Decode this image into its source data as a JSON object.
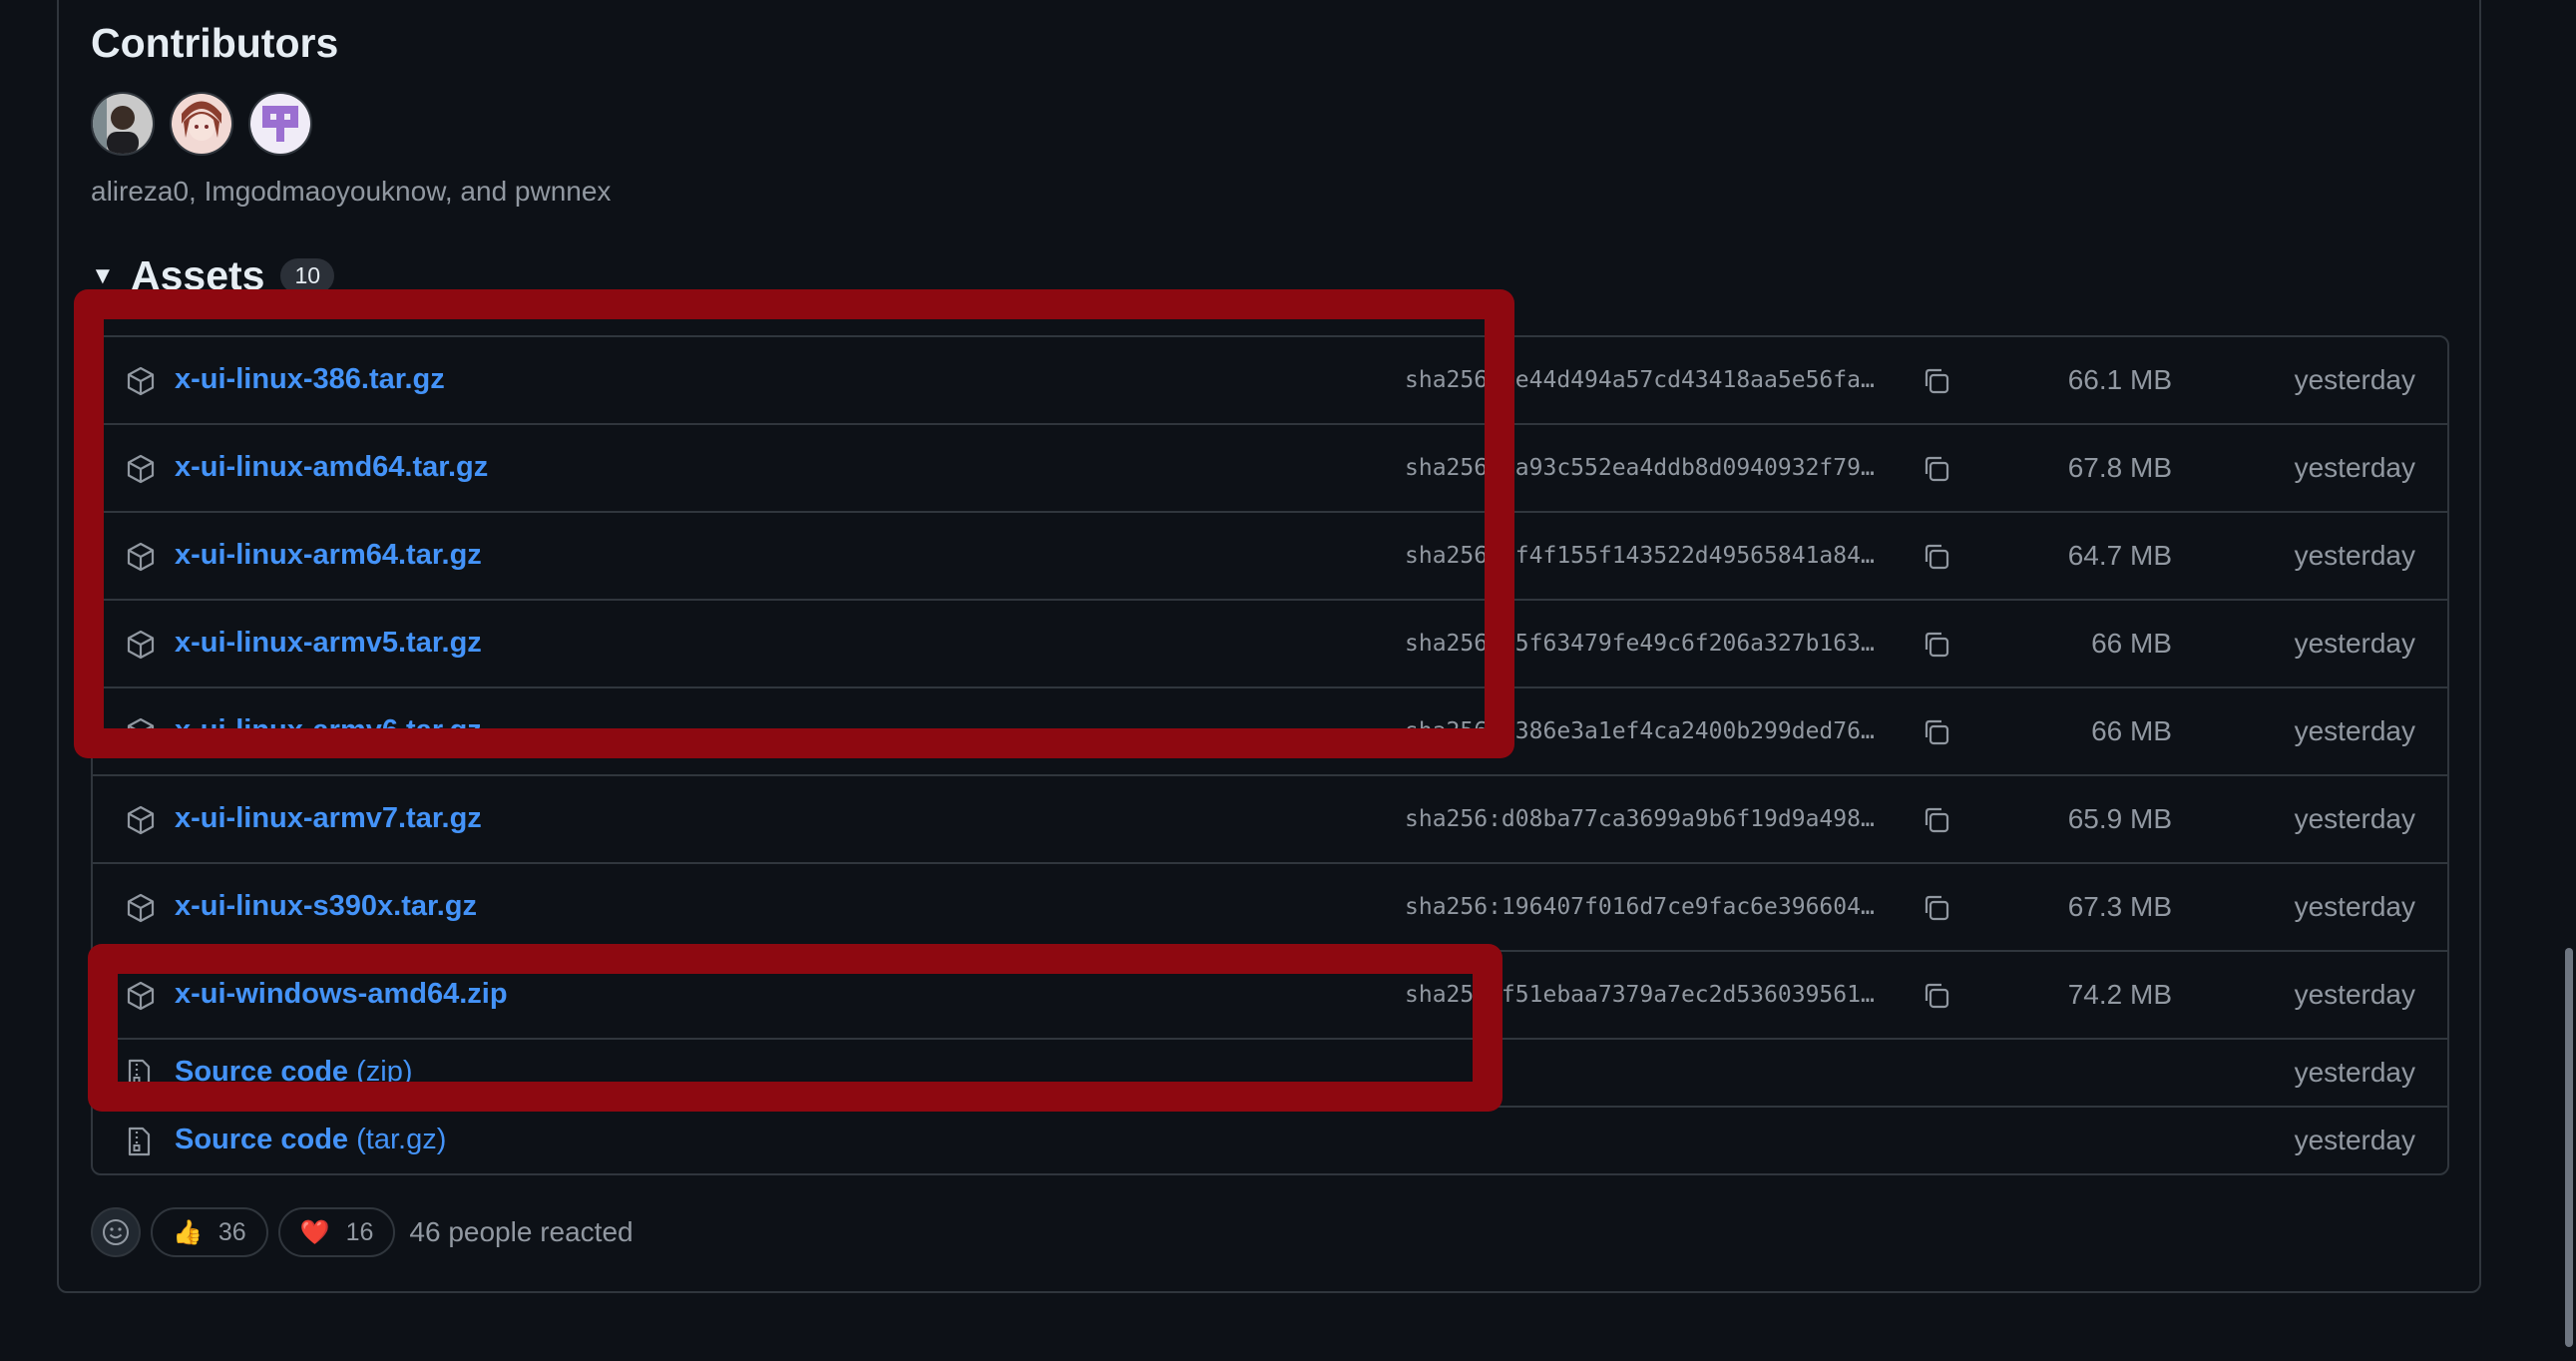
{
  "contributors": {
    "title": "Contributors",
    "names": "alireza0, Imgodmaoyouknow, and pwnnex",
    "avatars": [
      "avatar-alireza0",
      "avatar-imgodmaoyouknow",
      "avatar-pwnnex"
    ]
  },
  "assets": {
    "title": "Assets",
    "count": "10",
    "rows": [
      {
        "name": "x-ui-linux-386.tar.gz",
        "sha": "sha256:5e44d494a57cd43418aa5e56fa…",
        "size": "66.1 MB",
        "date": "yesterday"
      },
      {
        "name": "x-ui-linux-amd64.tar.gz",
        "sha": "sha256:ca93c552ea4ddb8d0940932f79…",
        "size": "67.8 MB",
        "date": "yesterday"
      },
      {
        "name": "x-ui-linux-arm64.tar.gz",
        "sha": "sha256:6f4f155f143522d49565841a84…",
        "size": "64.7 MB",
        "date": "yesterday"
      },
      {
        "name": "x-ui-linux-armv5.tar.gz",
        "sha": "sha256:f5f63479fe49c6f206a327b163…",
        "size": "66 MB",
        "date": "yesterday"
      },
      {
        "name": "x-ui-linux-armv6.tar.gz",
        "sha": "sha256:8386e3a1ef4ca2400b299ded76…",
        "size": "66 MB",
        "date": "yesterday"
      },
      {
        "name": "x-ui-linux-armv7.tar.gz",
        "sha": "sha256:d08ba77ca3699a9b6f19d9a498…",
        "size": "65.9 MB",
        "date": "yesterday"
      },
      {
        "name": "x-ui-linux-s390x.tar.gz",
        "sha": "sha256:196407f016d7ce9fac6e396604…",
        "size": "67.3 MB",
        "date": "yesterday"
      },
      {
        "name": "x-ui-windows-amd64.zip",
        "sha": "sha256:f51ebaa7379a7ec2d536039561…",
        "size": "74.2 MB",
        "date": "yesterday"
      }
    ],
    "source": [
      {
        "label": "Source code",
        "suffix": "(zip)",
        "date": "yesterday"
      },
      {
        "label": "Source code",
        "suffix": "(tar.gz)",
        "date": "yesterday"
      }
    ]
  },
  "reactions": {
    "thumbs_up_emoji": "👍",
    "thumbs_up_count": "36",
    "heart_emoji": "❤️",
    "heart_count": "16",
    "summary": "46 people reacted"
  },
  "colors": {
    "background": "#0d1117",
    "link": "#4493f8",
    "muted": "#9198a1",
    "border": "#30363d",
    "highlight": "#8e0810"
  }
}
